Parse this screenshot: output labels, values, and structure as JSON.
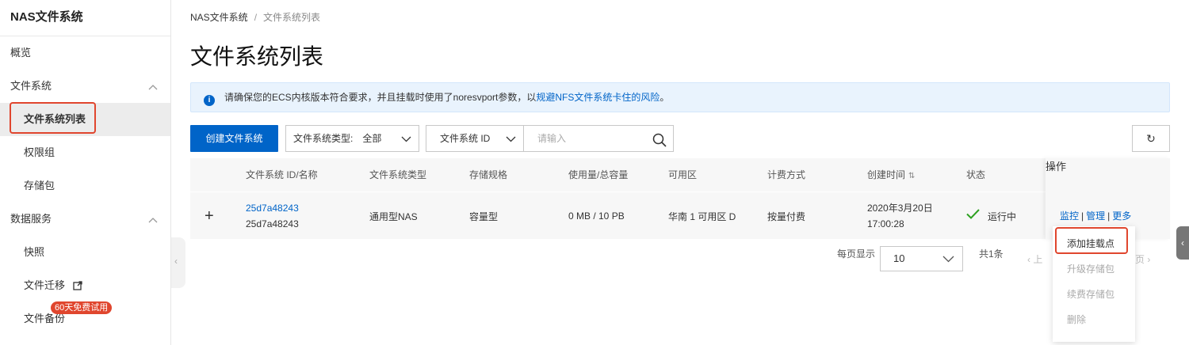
{
  "sidebar": {
    "title": "NAS文件系统",
    "items": [
      {
        "label": "概览"
      },
      {
        "label": "文件系统"
      },
      {
        "label": "文件系统列表"
      },
      {
        "label": "权限组"
      },
      {
        "label": "存储包"
      },
      {
        "label": "数据服务"
      },
      {
        "label": "快照"
      },
      {
        "label": "文件迁移"
      },
      {
        "label": "文件备份"
      }
    ],
    "trial_badge": "60天免费试用"
  },
  "breadcrumb": {
    "root": "NAS文件系统",
    "separator": "/",
    "current": "文件系统列表"
  },
  "page_title": "文件系统列表",
  "notice": {
    "text": "请确保您的ECS内核版本符合要求，并且挂载时使用了noresvport参数，以",
    "link": "规避NFS文件系统卡住的风险",
    "suffix": "。"
  },
  "toolbar": {
    "create_label": "创建文件系统",
    "type_filter_label": "文件系统类型:",
    "type_filter_value": "全部",
    "search_field": "文件系统 ID",
    "search_placeholder": "请输入"
  },
  "table": {
    "headers": [
      "文件系统 ID/名称",
      "文件系统类型",
      "存储规格",
      "使用量/总容量",
      "可用区",
      "计费方式",
      "创建时间",
      "状态",
      "操作"
    ],
    "rows": [
      {
        "expand": "+",
        "id": "25d7a48243",
        "name": "25d7a48243",
        "type": "通用型NAS",
        "spec": "容量型",
        "usage": "0 MB / 10 PB",
        "zone": "华南 1 可用区 D",
        "billing": "按量付费",
        "created_date": "2020年3月20日",
        "created_time": "17:00:28",
        "status": "运行中",
        "ops": {
          "monitor": "监控",
          "manage": "管理",
          "more": "更多"
        }
      }
    ]
  },
  "pagination": {
    "page_size_label": "每页显示",
    "page_size": "10",
    "total": "共1条",
    "prev": "上",
    "next": "页"
  },
  "dropdown": {
    "items": [
      "添加挂载点",
      "升级存储包",
      "续费存储包",
      "删除"
    ]
  },
  "colors": {
    "primary": "#0064c8",
    "highlight": "#e0462e",
    "success": "#2ea121"
  }
}
